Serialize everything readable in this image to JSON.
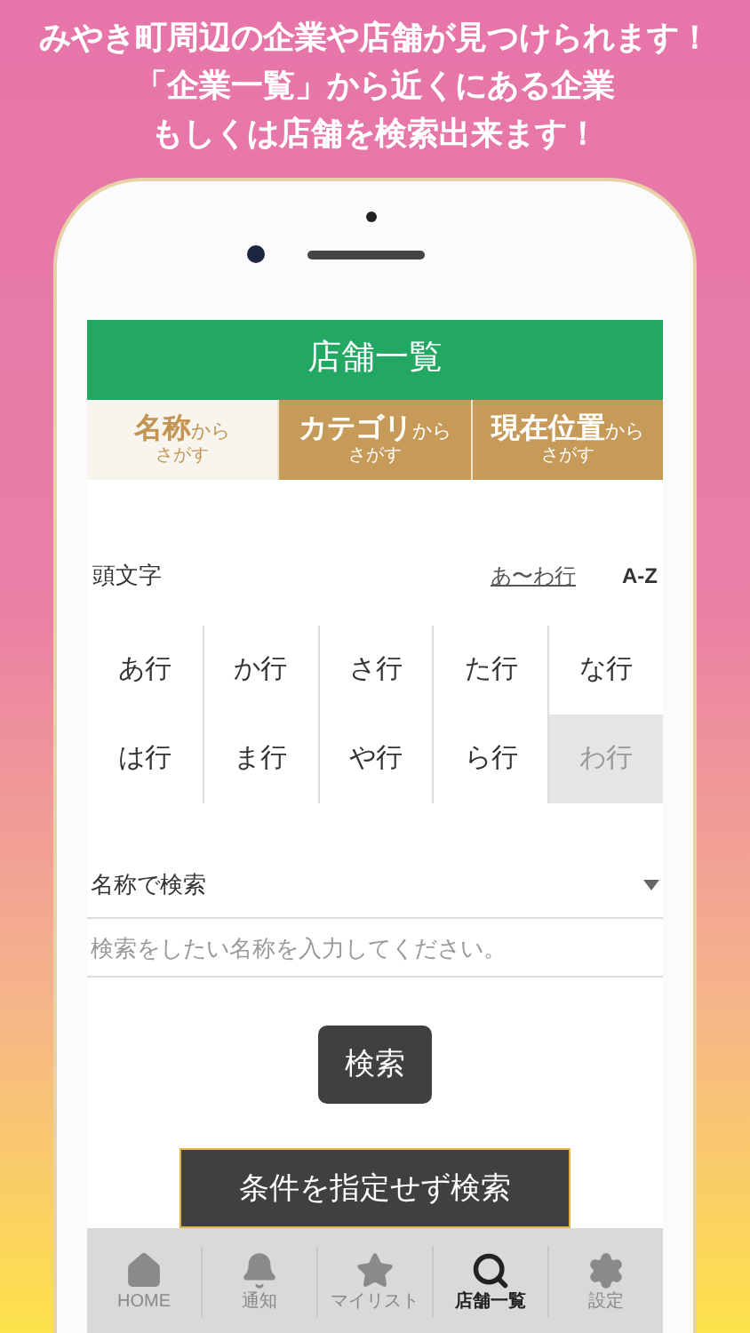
{
  "headline": [
    "みやき町周辺の企業や店舗が見つけられます！",
    "「企業一覧」から近くにある企業",
    "もしくは店舗を検索出来ます！"
  ],
  "header": {
    "title": "店舗一覧"
  },
  "tabs": [
    {
      "label": "名称",
      "suffix": "から",
      "sub": "さがす",
      "selected": true
    },
    {
      "label": "カテゴリ",
      "suffix": "から",
      "sub": "さがす",
      "selected": false
    },
    {
      "label": "現在位置",
      "suffix": "から",
      "sub": "さがす",
      "selected": false
    }
  ],
  "initials": {
    "label": "頭文字",
    "modes": [
      {
        "label": "あ〜わ行",
        "selected": true
      },
      {
        "label": "A-Z",
        "selected": false
      }
    ]
  },
  "rows": [
    {
      "label": "あ行",
      "disabled": false
    },
    {
      "label": "か行",
      "disabled": false
    },
    {
      "label": "さ行",
      "disabled": false
    },
    {
      "label": "た行",
      "disabled": false
    },
    {
      "label": "な行",
      "disabled": false
    },
    {
      "label": "は行",
      "disabled": false
    },
    {
      "label": "ま行",
      "disabled": false
    },
    {
      "label": "や行",
      "disabled": false
    },
    {
      "label": "ら行",
      "disabled": false
    },
    {
      "label": "わ行",
      "disabled": true
    }
  ],
  "search_type": {
    "value": "名称で検索"
  },
  "search_input": {
    "placeholder": "検索をしたい名称を入力してください。"
  },
  "search_button": "検索",
  "search_all_button": "条件を指定せず検索",
  "tab_bar": [
    {
      "label": "HOME",
      "kind": "home",
      "selected": false
    },
    {
      "label": "通知",
      "kind": "bell",
      "selected": false
    },
    {
      "label": "マイリスト",
      "kind": "star",
      "selected": false
    },
    {
      "label": "店舗一覧",
      "kind": "search",
      "selected": true
    },
    {
      "label": "設定",
      "kind": "gear",
      "selected": false
    }
  ]
}
